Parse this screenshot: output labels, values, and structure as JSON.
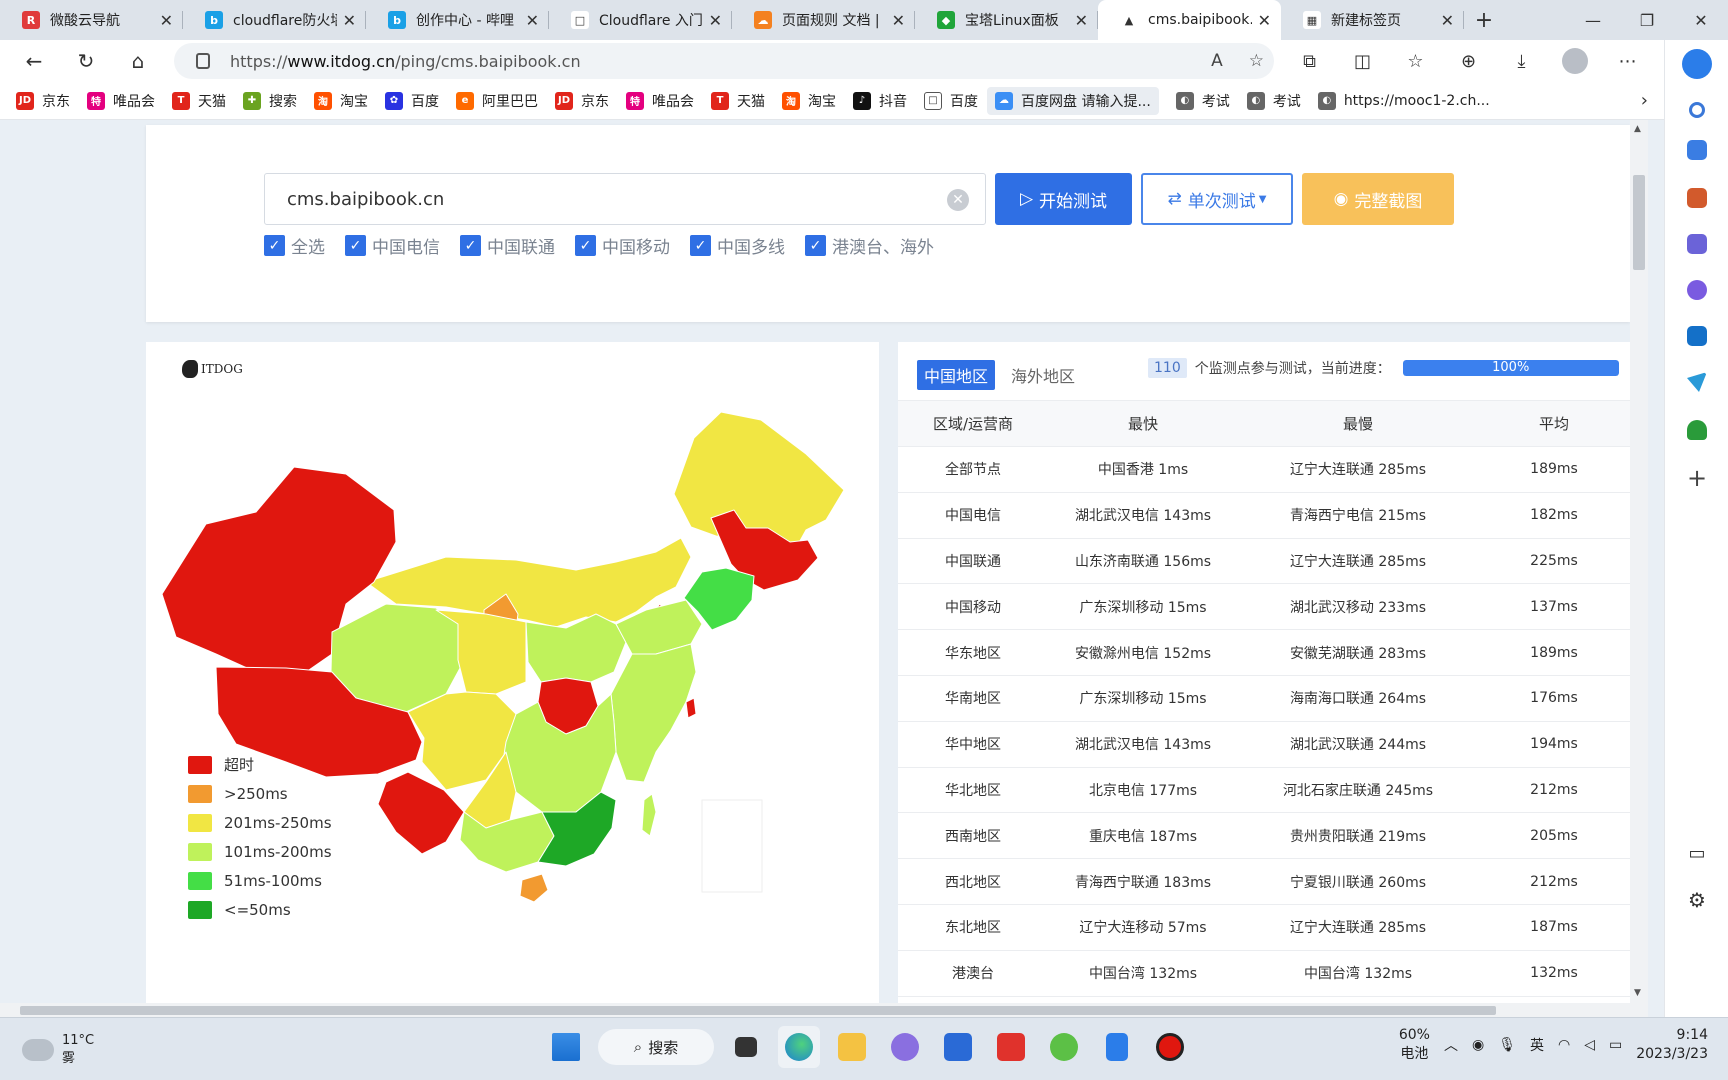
{
  "tabs": [
    {
      "title": "微酸云导航",
      "color": "#e03b3b",
      "glyph": "R"
    },
    {
      "title": "cloudflare防火墙",
      "color": "#1aa0e6",
      "glyph": "b"
    },
    {
      "title": "创作中心 - 哔哩",
      "color": "#1aa0e6",
      "glyph": "b"
    },
    {
      "title": "Cloudflare 入门",
      "color": "#ffffff",
      "glyph": "□"
    },
    {
      "title": "页面规则 文档 |",
      "color": "#f48120",
      "glyph": "☁"
    },
    {
      "title": "宝塔Linux面板",
      "color": "#20a53a",
      "glyph": "◆"
    },
    {
      "title": "cms.baipibook.c",
      "color": "#ffffff",
      "glyph": "▲"
    },
    {
      "title": "新建标签页",
      "color": "#ffffff",
      "glyph": "▦"
    }
  ],
  "active_tab": 6,
  "address": {
    "prefix": "https://",
    "domain": "www.itdog.cn",
    "path": "/ping/cms.baipibook.cn"
  },
  "bookmarks": [
    {
      "label": "京东",
      "color": "#e1251b",
      "glyph": "JD"
    },
    {
      "label": "唯品会",
      "color": "#e4007f",
      "glyph": "特"
    },
    {
      "label": "天猫",
      "color": "#e1251b",
      "glyph": "T"
    },
    {
      "label": "搜索",
      "color": "#6aa320",
      "glyph": "✚"
    },
    {
      "label": "淘宝",
      "color": "#ff5000",
      "glyph": "淘"
    },
    {
      "label": "百度",
      "color": "#2932e1",
      "glyph": "✿"
    },
    {
      "label": "阿里巴巴",
      "color": "#ff6a00",
      "glyph": "e"
    },
    {
      "label": "京东",
      "color": "#e1251b",
      "glyph": "JD"
    },
    {
      "label": "唯品会",
      "color": "#e4007f",
      "glyph": "特"
    },
    {
      "label": "天猫",
      "color": "#e1251b",
      "glyph": "T"
    },
    {
      "label": "淘宝",
      "color": "#ff5000",
      "glyph": "淘"
    },
    {
      "label": "抖音",
      "color": "#111111",
      "glyph": "♪"
    },
    {
      "label": "百度",
      "color": "#ffffff",
      "glyph": "□"
    },
    {
      "label": "百度网盘 请输入提...",
      "color": "#3b8ff5",
      "glyph": "☁"
    },
    {
      "label": "考试",
      "color": "#666666",
      "glyph": "◐"
    },
    {
      "label": "考试",
      "color": "#666666",
      "glyph": "◐"
    },
    {
      "label": "https://mooc1-2.ch...",
      "color": "#666666",
      "glyph": "◐"
    }
  ],
  "search": {
    "value": "cms.baipibook.cn",
    "start": "开始测试",
    "single": "单次测试",
    "shot": "完整截图"
  },
  "checks": [
    "全选",
    "中国电信",
    "中国联通",
    "中国移动",
    "中国多线",
    "港澳台、海外"
  ],
  "logo_text": "ITDOG",
  "legend": [
    {
      "label": "超时",
      "color": "#e0170f"
    },
    {
      "label": ">250ms",
      "color": "#f29a30"
    },
    {
      "label": "201ms-250ms",
      "color": "#f1e643"
    },
    {
      "label": "101ms-200ms",
      "color": "#bff25b"
    },
    {
      "label": "51ms-100ms",
      "color": "#44de46"
    },
    {
      "label": "<=50ms",
      "color": "#1ea826"
    }
  ],
  "region_tabs": [
    "中国地区",
    "海外地区"
  ],
  "monitor": {
    "count": "110",
    "text": "个监测点参与测试，当前进度：",
    "progress": 1.0,
    "progress_label": "100%"
  },
  "table": {
    "headers": [
      "区域/运营商",
      "最快",
      "最慢",
      "平均"
    ],
    "rows": [
      [
        "全部节点",
        "中国香港 1ms",
        "辽宁大连联通 285ms",
        "189ms"
      ],
      [
        "中国电信",
        "湖北武汉电信 143ms",
        "青海西宁电信 215ms",
        "182ms"
      ],
      [
        "中国联通",
        "山东济南联通 156ms",
        "辽宁大连联通 285ms",
        "225ms"
      ],
      [
        "中国移动",
        "广东深圳移动 15ms",
        "湖北武汉移动 233ms",
        "137ms"
      ],
      [
        "华东地区",
        "安徽滁州电信 152ms",
        "安徽芜湖联通 283ms",
        "189ms"
      ],
      [
        "华南地区",
        "广东深圳移动 15ms",
        "海南海口联通 264ms",
        "176ms"
      ],
      [
        "华中地区",
        "湖北武汉电信 143ms",
        "湖北武汉联通 244ms",
        "194ms"
      ],
      [
        "华北地区",
        "北京电信 177ms",
        "河北石家庄联通 245ms",
        "212ms"
      ],
      [
        "西南地区",
        "重庆电信 187ms",
        "贵州贵阳联通 219ms",
        "205ms"
      ],
      [
        "西北地区",
        "青海西宁联通 183ms",
        "宁夏银川联通 260ms",
        "212ms"
      ],
      [
        "东北地区",
        "辽宁大连移动 57ms",
        "辽宁大连联通 285ms",
        "187ms"
      ],
      [
        "港澳台",
        "中国台湾 132ms",
        "中国台湾 132ms",
        "132ms"
      ]
    ]
  },
  "taskbar": {
    "temp": "11°C",
    "weather": "雾",
    "search": "搜索",
    "battery_pct": "60%",
    "battery_label": "电池",
    "ime": "英",
    "time": "9:14",
    "date": "2023/3/23"
  }
}
